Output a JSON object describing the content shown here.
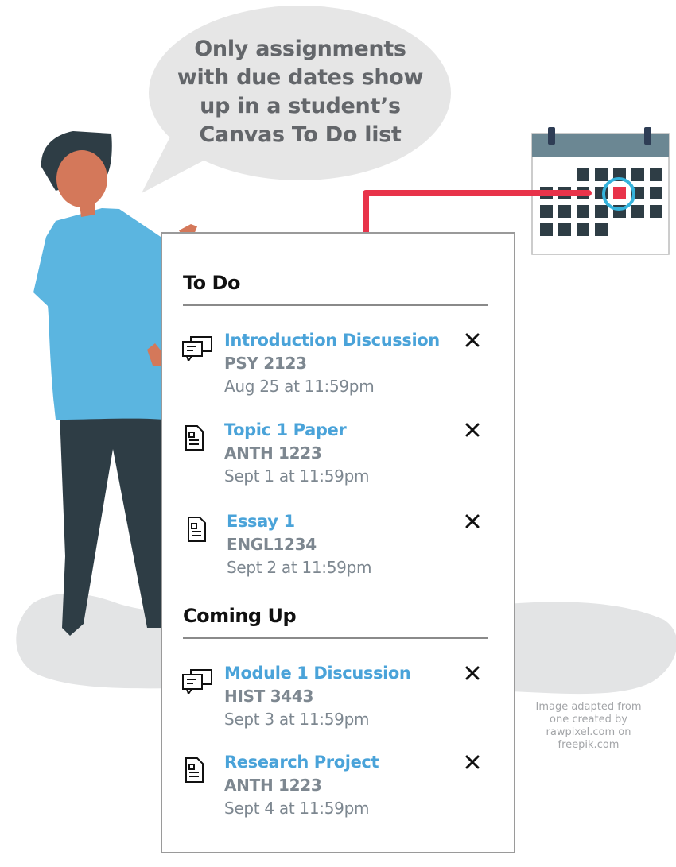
{
  "speech_bubble": {
    "lines": [
      "Only assignments",
      "with due dates show",
      "up in a student’s",
      "Canvas To Do list"
    ]
  },
  "colors": {
    "link_blue": "#4aa3d9",
    "meta_gray": "#7d8790",
    "arrow_red": "#e8334a",
    "highlight_cyan": "#35b3dc",
    "shirt_blue": "#5bb5e0",
    "dark_slate": "#2e3d45",
    "skin": "#d4785a",
    "bubble_gray": "#e6e6e6",
    "calendar_header": "#6b8793"
  },
  "todo_panel": {
    "sections": [
      {
        "title": "To Do",
        "items": [
          {
            "icon": "discussion-icon",
            "title": "Introduction Discussion",
            "course": "PSY 2123",
            "due": "Aug 25 at 11:59pm"
          },
          {
            "icon": "assignment-icon",
            "title": "Topic 1 Paper",
            "course": "ANTH 1223",
            "due": "Sept 1 at 11:59pm"
          },
          {
            "icon": "assignment-icon",
            "title": "Essay 1",
            "course": "ENGL1234",
            "due": "Sept 2 at 11:59pm"
          }
        ]
      },
      {
        "title": "Coming Up",
        "items": [
          {
            "icon": "discussion-icon",
            "title": "Module 1 Discussion",
            "course": "HIST 3443",
            "due": "Sept 3 at 11:59pm"
          },
          {
            "icon": "assignment-icon",
            "title": "Research Project",
            "course": "ANTH 1223",
            "due": "Sept 4 at 11:59pm"
          }
        ]
      }
    ],
    "dismiss_icon": "close-icon"
  },
  "credit": {
    "lines": [
      "Image adapted from",
      "one created by",
      "rawpixel.com on",
      "freepik.com"
    ]
  }
}
